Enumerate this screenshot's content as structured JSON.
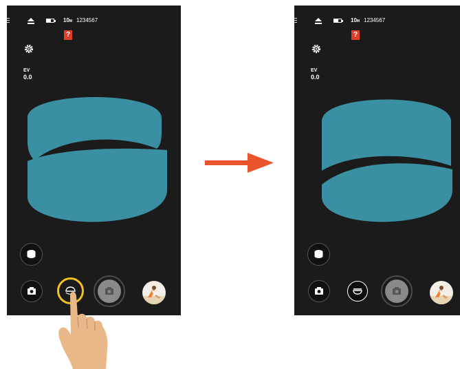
{
  "colors": {
    "screen_bg": "#1b1b1b",
    "lens_teal": "#3a8fa3",
    "highlight_ring": "#f4c220",
    "arrow": "#e9542b",
    "card_warning": "#e0402a",
    "hand_skin": "#e8b888"
  },
  "screens": [
    {
      "status": {
        "resolution": "10",
        "resolution_unit": "M",
        "count": "1234567",
        "card_icon": "?"
      },
      "ev": {
        "label": "EV",
        "value": "0.0"
      },
      "icons": [
        "menu-icon",
        "eject-icon",
        "battery-icon",
        "settings-icon",
        "lens-mode-icon",
        "photo-mode-icon",
        "view-mode-icon",
        "shutter-icon",
        "thumbnail"
      ],
      "view_mode_selected": false
    },
    {
      "status": {
        "resolution": "10",
        "resolution_unit": "M",
        "count": "1234567",
        "card_icon": "?"
      },
      "ev": {
        "label": "EV",
        "value": "0.0"
      },
      "icons": [
        "menu-icon",
        "eject-icon",
        "battery-icon",
        "settings-icon",
        "lens-mode-icon",
        "photo-mode-icon",
        "view-mode-icon",
        "shutter-icon",
        "thumbnail"
      ],
      "view_mode_selected": true
    }
  ]
}
